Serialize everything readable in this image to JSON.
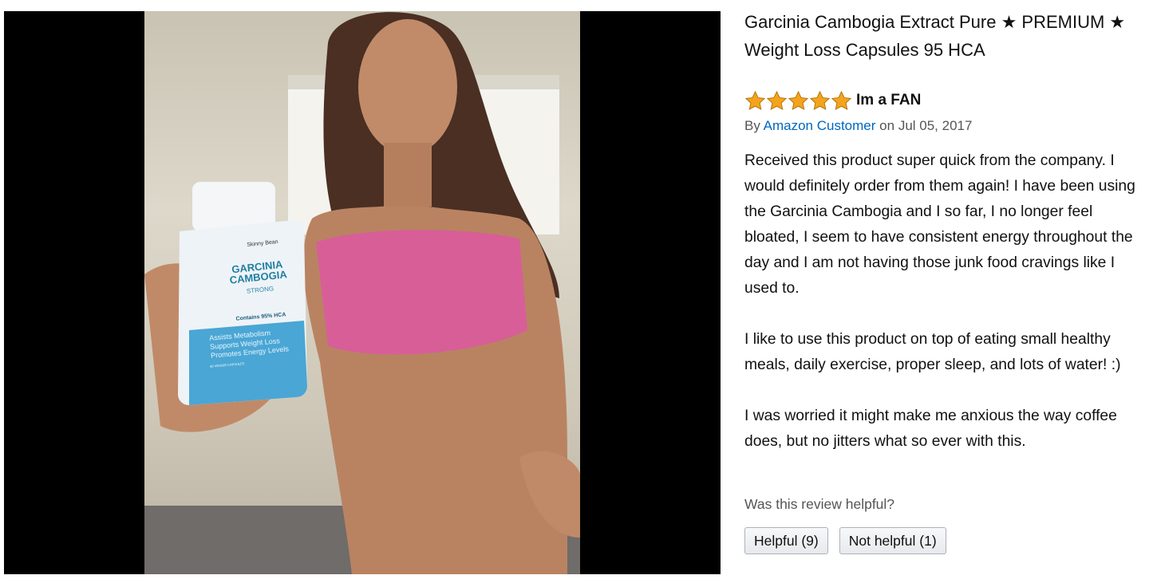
{
  "product": {
    "title": "Garcinia Cambogia Extract Pure ★ PREMIUM ★ Weight Loss Capsules 95 HCA"
  },
  "review": {
    "rating": 5,
    "rating_max": 5,
    "star_color": "#f4a41c",
    "title": "Im a FAN",
    "byline_prefix": "By",
    "author": "Amazon Customer",
    "date_prefix": "on",
    "date": "Jul 05, 2017",
    "paragraphs": [
      "Received this product super quick from the company. I would definitely order from them again! I have been using the Garcinia Cambogia and I so far, I no longer feel bloated, I seem to have consistent energy throughout the day and I am not having those junk food cravings like I used to.",
      "I like to use this product on top of eating small healthy meals, daily exercise, proper sleep, and lots of water! :)",
      "I was worried it might make me anxious the way coffee does, but no jitters what so ever with this."
    ]
  },
  "feedback": {
    "prompt": "Was this review helpful?",
    "helpful_label": "Helpful (9)",
    "not_helpful_label": "Not helpful (1)"
  },
  "photo": {
    "bottle_brand": "Skinny Bean",
    "bottle_name": "GARCINIA CAMBOGIA",
    "bottle_strength": "STRONG",
    "bottle_hca": "Contains 95% HCA",
    "bottle_claims": [
      "Assists Metabolism",
      "Supports Weight Loss",
      "Promotes Energy Levels"
    ],
    "bottle_capsules": "60 VEGGIE CAPSULES"
  },
  "colors": {
    "link": "#0066c0",
    "panel_background": "#000000"
  }
}
